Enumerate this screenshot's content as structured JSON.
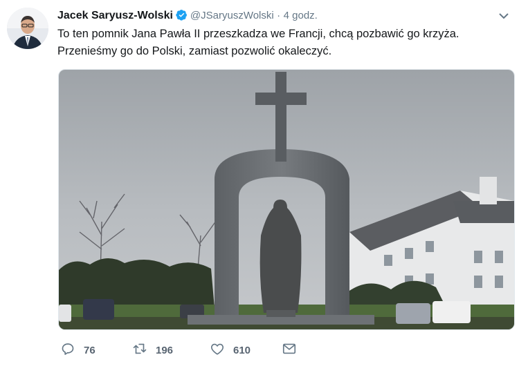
{
  "tweet": {
    "author_name": "Jacek Saryusz-Wolski",
    "handle": "@JSaryuszWolski",
    "separator": "·",
    "time": "4 godz.",
    "text_line1": "To ten pomnik Jana Pawła II przeszkadza we Francji, chcą pozbawić go krzyża.",
    "text_line2": "Przenieśmy go do Polski, zamiast pozwolić okaleczyć."
  },
  "actions": {
    "replies": "76",
    "retweets": "196",
    "likes": "610"
  },
  "icons": {
    "verified": "verified-badge-icon",
    "menu": "chevron-down-icon",
    "reply": "reply-icon",
    "retweet": "retweet-icon",
    "like": "heart-icon",
    "message": "envelope-icon"
  },
  "colors": {
    "verified": "#1da1f2",
    "muted": "#657786",
    "text": "#14171a"
  }
}
